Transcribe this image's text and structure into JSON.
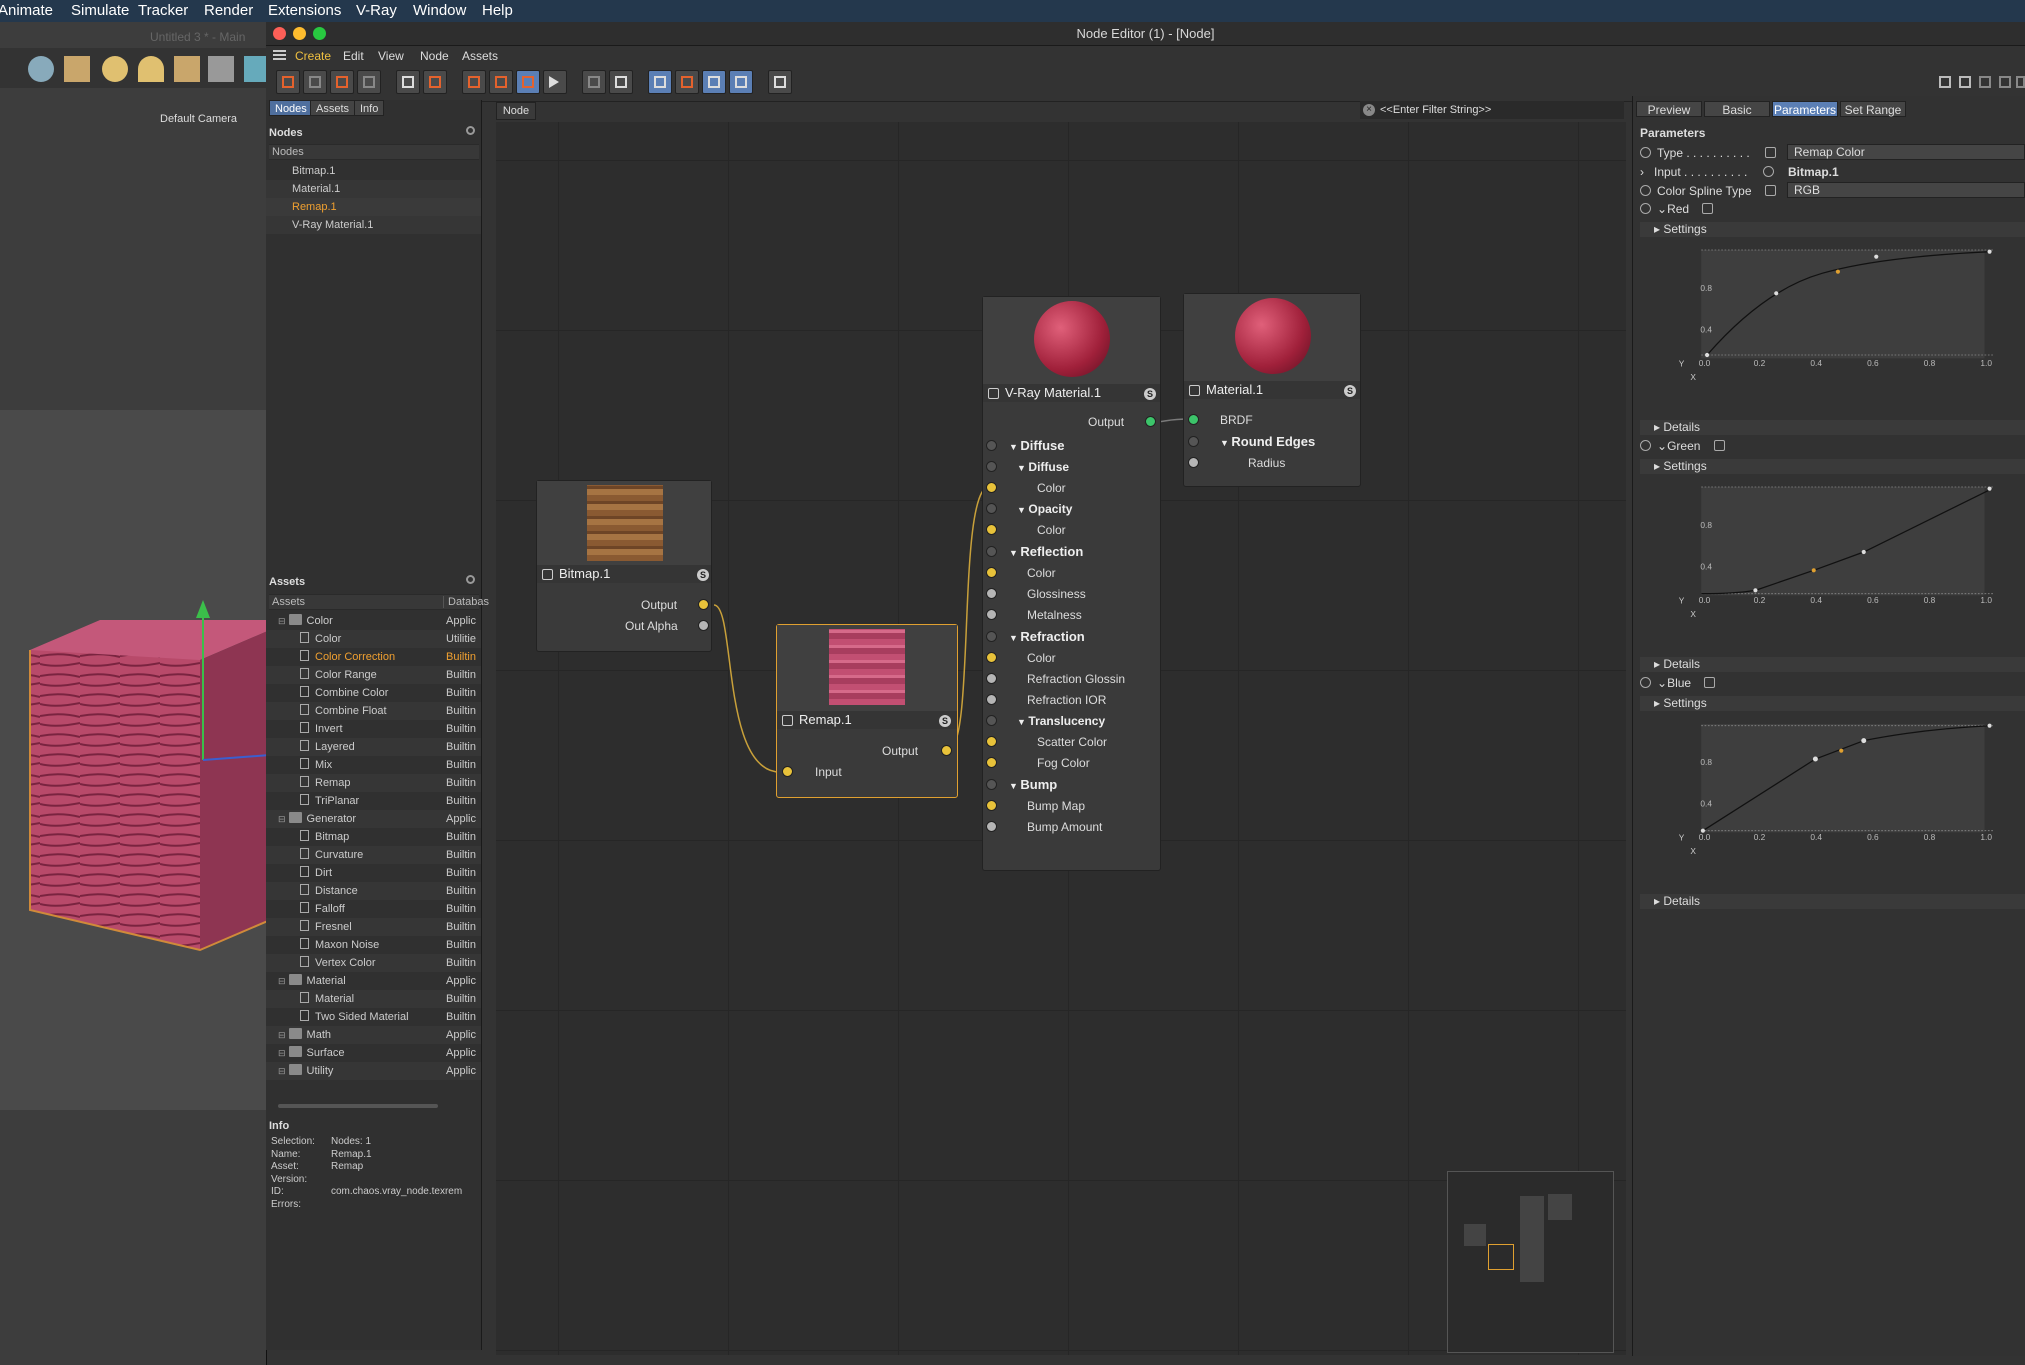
{
  "menubar": {
    "items": [
      "Animate",
      "Simulate",
      "Tracker",
      "Render",
      "Extensions",
      "V-Ray",
      "Window",
      "Help"
    ]
  },
  "viewport": {
    "doc_title": "Untitled 3 * - Main",
    "camera": "Default Camera"
  },
  "window": {
    "title": "Node Editor (1) - [Node]"
  },
  "editor_menu": {
    "items": [
      "Create",
      "Edit",
      "View",
      "Node",
      "Assets"
    ]
  },
  "left_tabs": [
    "Nodes",
    "Assets",
    "Info"
  ],
  "nodes_panel": {
    "title": "Nodes",
    "column": "Nodes",
    "items": [
      "Bitmap.1",
      "Material.1",
      "Remap.1",
      "V-Ray Material.1"
    ]
  },
  "assets_panel": {
    "title": "Assets",
    "col_asset": "Assets",
    "col_db": "Databas",
    "rows": [
      {
        "label": "Color",
        "db": "Applic",
        "type": "folder",
        "indent": 0
      },
      {
        "label": "Color",
        "db": "Utilitie",
        "type": "item",
        "indent": 1
      },
      {
        "label": "Color Correction",
        "db": "Builtin",
        "type": "item",
        "indent": 1,
        "selected": true
      },
      {
        "label": "Color Range",
        "db": "Builtin",
        "type": "item",
        "indent": 1
      },
      {
        "label": "Combine Color",
        "db": "Builtin",
        "type": "item",
        "indent": 1
      },
      {
        "label": "Combine Float",
        "db": "Builtin",
        "type": "item",
        "indent": 1
      },
      {
        "label": "Invert",
        "db": "Builtin",
        "type": "item",
        "indent": 1
      },
      {
        "label": "Layered",
        "db": "Builtin",
        "type": "item",
        "indent": 1
      },
      {
        "label": "Mix",
        "db": "Builtin",
        "type": "item",
        "indent": 1
      },
      {
        "label": "Remap",
        "db": "Builtin",
        "type": "item",
        "indent": 1
      },
      {
        "label": "TriPlanar",
        "db": "Builtin",
        "type": "item",
        "indent": 1
      },
      {
        "label": "Generator",
        "db": "Applic",
        "type": "folder",
        "indent": 0
      },
      {
        "label": "Bitmap",
        "db": "Builtin",
        "type": "item",
        "indent": 1
      },
      {
        "label": "Curvature",
        "db": "Builtin",
        "type": "item",
        "indent": 1
      },
      {
        "label": "Dirt",
        "db": "Builtin",
        "type": "item",
        "indent": 1
      },
      {
        "label": "Distance",
        "db": "Builtin",
        "type": "item",
        "indent": 1
      },
      {
        "label": "Falloff",
        "db": "Builtin",
        "type": "item",
        "indent": 1
      },
      {
        "label": "Fresnel",
        "db": "Builtin",
        "type": "item",
        "indent": 1
      },
      {
        "label": "Maxon Noise",
        "db": "Builtin",
        "type": "item",
        "indent": 1
      },
      {
        "label": "Vertex Color",
        "db": "Builtin",
        "type": "item",
        "indent": 1
      },
      {
        "label": "Material",
        "db": "Applic",
        "type": "folder",
        "indent": 0
      },
      {
        "label": "Material",
        "db": "Builtin",
        "type": "item",
        "indent": 1
      },
      {
        "label": "Two Sided Material",
        "db": "Builtin",
        "type": "item",
        "indent": 1
      },
      {
        "label": "Math",
        "db": "Applic",
        "type": "folder",
        "indent": 0
      },
      {
        "label": "Surface",
        "db": "Applic",
        "type": "folder",
        "indent": 0
      },
      {
        "label": "Utility",
        "db": "Applic",
        "type": "folder",
        "indent": 0
      }
    ]
  },
  "info_panel": {
    "title": "Info",
    "rows": [
      {
        "k": "Selection:",
        "v": "Nodes: 1"
      },
      {
        "k": "Name:",
        "v": "Remap.1"
      },
      {
        "k": "Asset:",
        "v": "Remap"
      },
      {
        "k": "Version:",
        "v": ""
      },
      {
        "k": "ID:",
        "v": "com.chaos.vray_node.texrem"
      },
      {
        "k": "Errors:",
        "v": ""
      }
    ]
  },
  "graph": {
    "crumb": "Node",
    "filter_placeholder": "<<Enter Filter String>>"
  },
  "nodes": {
    "bitmap": {
      "title": "Bitmap.1",
      "ports": [
        "Output",
        "Out Alpha"
      ]
    },
    "remap": {
      "title": "Remap.1",
      "ports": [
        "Output",
        "Input"
      ]
    },
    "vray": {
      "title": "V-Ray Material.1",
      "output": "Output",
      "ports": [
        {
          "label": "Diffuse",
          "kind": "group"
        },
        {
          "label": "Diffuse",
          "kind": "sub"
        },
        {
          "label": "Color",
          "kind": "p2",
          "dot": "dy"
        },
        {
          "label": "Opacity",
          "kind": "sub"
        },
        {
          "label": "Color",
          "kind": "p2",
          "dot": "dy"
        },
        {
          "label": "Reflection",
          "kind": "group"
        },
        {
          "label": "Color",
          "kind": "p1",
          "dot": "dy"
        },
        {
          "label": "Glossiness",
          "kind": "p1",
          "dot": "dw"
        },
        {
          "label": "Metalness",
          "kind": "p1",
          "dot": "dw"
        },
        {
          "label": "Refraction",
          "kind": "group"
        },
        {
          "label": "Color",
          "kind": "p1",
          "dot": "dy"
        },
        {
          "label": "Refraction Glossin",
          "kind": "p1",
          "dot": "dw"
        },
        {
          "label": "Refraction IOR",
          "kind": "p1",
          "dot": "dw"
        },
        {
          "label": "Translucency",
          "kind": "sub"
        },
        {
          "label": "Scatter Color",
          "kind": "p2",
          "dot": "dy"
        },
        {
          "label": "Fog Color",
          "kind": "p2",
          "dot": "dy"
        },
        {
          "label": "Bump",
          "kind": "group"
        },
        {
          "label": "Bump Map",
          "kind": "p1",
          "dot": "dy"
        },
        {
          "label": "Bump Amount",
          "kind": "p1",
          "dot": "dw"
        }
      ]
    },
    "material": {
      "title": "Material.1",
      "ports": [
        "BRDF",
        "Round Edges",
        "Radius"
      ]
    }
  },
  "right_tabs": [
    "Preview",
    "Basic",
    "Parameters",
    "Set Range"
  ],
  "params": {
    "title": "Parameters",
    "type_label": "Type . . . . . . . . . .",
    "type_value": "Remap Color",
    "input_label": "Input . . . . . . . . . .",
    "input_value": "Bitmap.1",
    "spline_label": "Color Spline Type",
    "spline_value": "RGB",
    "channels": [
      "Red",
      "Green",
      "Blue"
    ],
    "settings": "Settings",
    "details": "Details",
    "axis_y": "Y",
    "axis_x": "X",
    "ticks_x": [
      "0.0",
      "0.2",
      "0.4",
      "0.6",
      "0.8",
      "1.0"
    ],
    "ticks_y": [
      "0.8",
      "0.4"
    ]
  }
}
